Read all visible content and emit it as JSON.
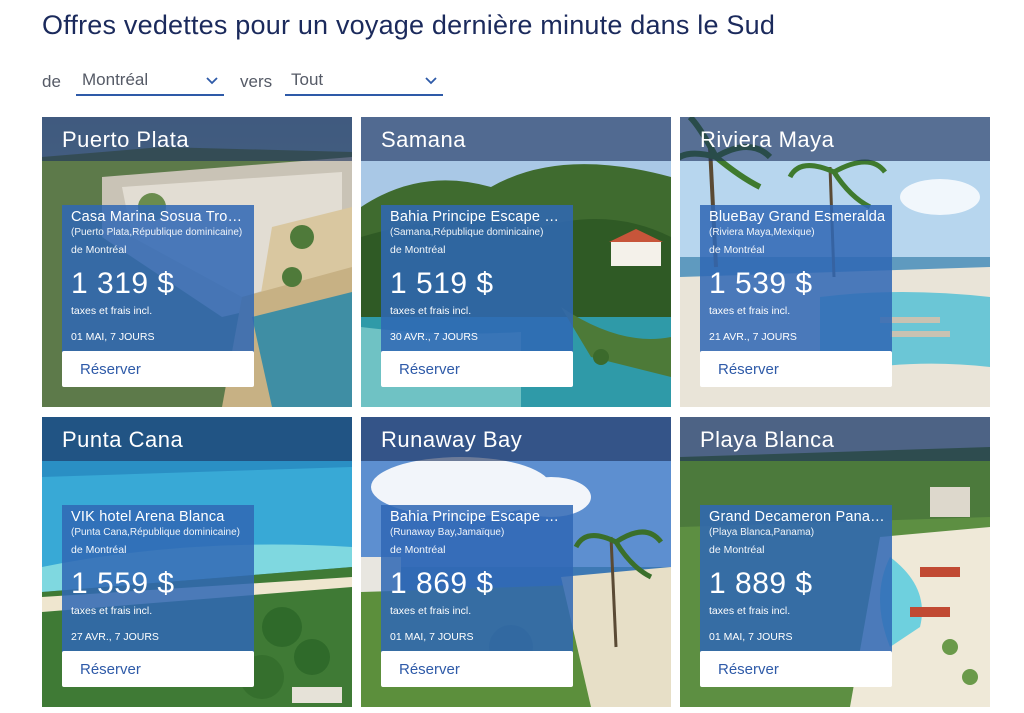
{
  "page": {
    "title": "Offres vedettes pour un voyage dernière minute dans le Sud"
  },
  "filters": {
    "from_label": "de",
    "from_value": "Montréal",
    "to_label": "vers",
    "to_value": "Tout"
  },
  "colors": {
    "accent": "#2e5aa8",
    "panel": "#3068b4",
    "title_band": "#1c305c"
  },
  "deals": [
    {
      "destination": "Puerto Plata",
      "hotel": "Casa Marina Sosua Tropical",
      "location": "(Puerto Plata,République dominicaine)",
      "from": "de Montréal",
      "price": "1 319 $",
      "taxes": "taxes et frais incl.",
      "dates": "01 MAI,  7 JOURS",
      "cta": "Réserver"
    },
    {
      "destination": "Samana",
      "hotel": "Bahia Principe Escape Cayo Levantado",
      "location": "(Samana,République dominicaine)",
      "from": "de Montréal",
      "price": "1 519 $",
      "taxes": "taxes et frais incl.",
      "dates": "30 AVR.,  7 JOURS",
      "cta": "Réserver"
    },
    {
      "destination": "Riviera Maya",
      "hotel": "BlueBay Grand Esmeralda",
      "location": "(Riviera Maya,Mexique)",
      "from": "de Montréal",
      "price": "1 539 $",
      "taxes": "taxes et frais incl.",
      "dates": "21 AVR.,  7 JOURS",
      "cta": "Réserver"
    },
    {
      "destination": "Punta Cana",
      "hotel": "VIK hotel Arena Blanca",
      "location": "(Punta Cana,République dominicaine)",
      "from": "de Montréal",
      "price": "1 559 $",
      "taxes": "taxes et frais incl.",
      "dates": "27 AVR.,  7 JOURS",
      "cta": "Réserver"
    },
    {
      "destination": "Runaway Bay",
      "hotel": "Bahia Principe Escape Runaway Bay",
      "location": "(Runaway Bay,Jamaïque)",
      "from": "de Montréal",
      "price": "1 869 $",
      "taxes": "taxes et frais incl.",
      "dates": "01 MAI,  7 JOURS",
      "cta": "Réserver"
    },
    {
      "destination": "Playa Blanca",
      "hotel": "Grand Decameron Panamá",
      "location": "(Playa Blanca,Panama)",
      "from": "de Montréal",
      "price": "1 889 $",
      "taxes": "taxes et frais incl.",
      "dates": "01 MAI,  7 JOURS",
      "cta": "Réserver"
    }
  ]
}
